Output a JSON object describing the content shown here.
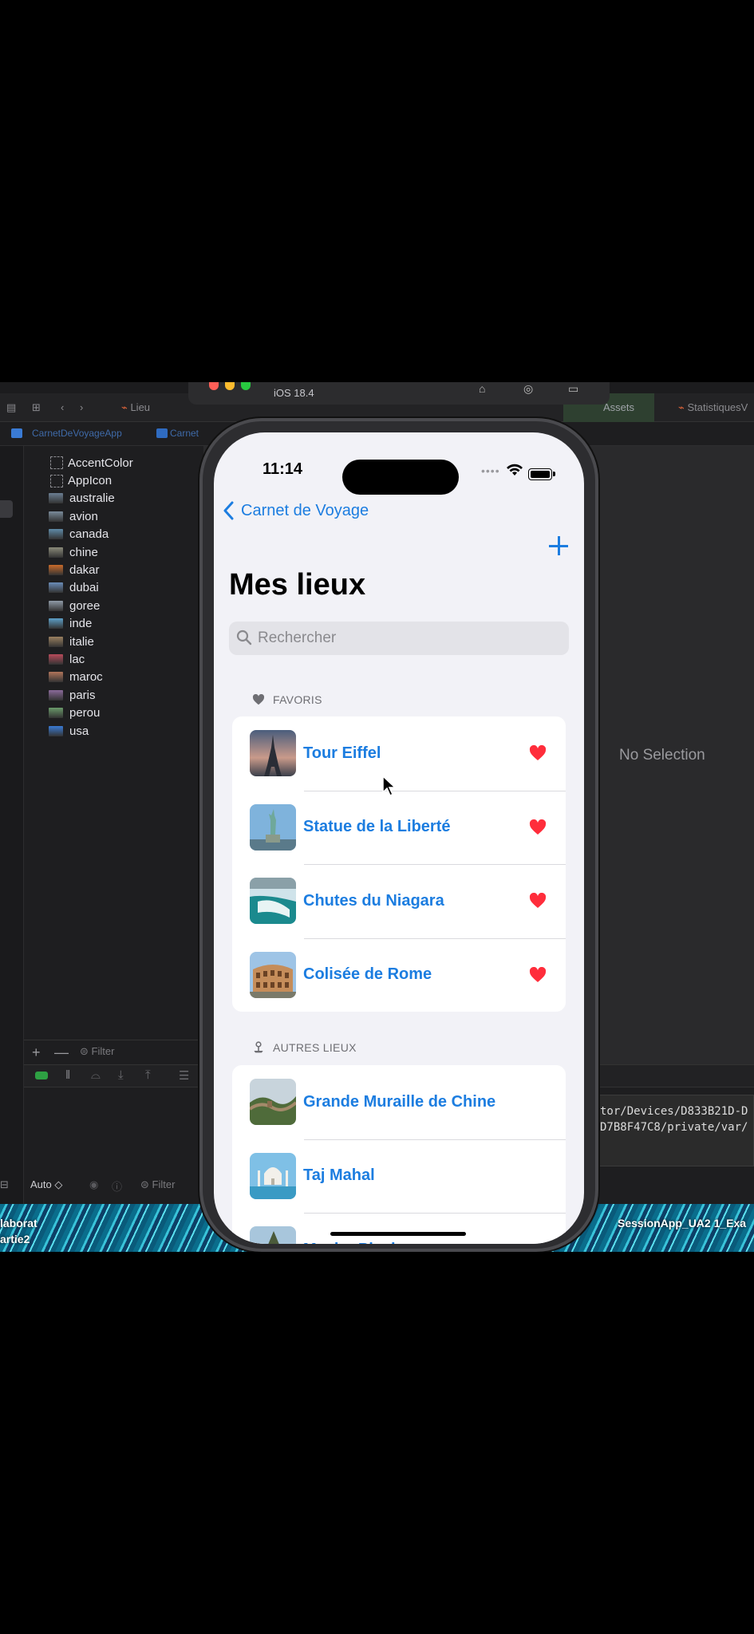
{
  "xcode": {
    "tabs": [
      "Lieu",
      "Assets",
      "StatistiquesV"
    ],
    "path": [
      "CarnetDeVoyageApp",
      "Carnet"
    ],
    "assets": [
      {
        "name": "AccentColor",
        "kind": "color"
      },
      {
        "name": "AppIcon",
        "kind": "icon"
      },
      {
        "name": "australie",
        "kind": "image",
        "color": "#6b7f93"
      },
      {
        "name": "avion",
        "kind": "image",
        "color": "#7a8a9a"
      },
      {
        "name": "canada",
        "kind": "image",
        "color": "#5f8aa8"
      },
      {
        "name": "chine",
        "kind": "image",
        "color": "#8a8a7a"
      },
      {
        "name": "dakar",
        "kind": "image",
        "color": "#c86a2a"
      },
      {
        "name": "dubai",
        "kind": "image",
        "color": "#6a8cb8"
      },
      {
        "name": "goree",
        "kind": "image",
        "color": "#8e9aa6"
      },
      {
        "name": "inde",
        "kind": "image",
        "color": "#5da0c8"
      },
      {
        "name": "italie",
        "kind": "image",
        "color": "#9a8060"
      },
      {
        "name": "lac",
        "kind": "image",
        "color": "#b84b5a"
      },
      {
        "name": "maroc",
        "kind": "image",
        "color": "#b0755a"
      },
      {
        "name": "paris",
        "kind": "image",
        "color": "#8a6a9a"
      },
      {
        "name": "perou",
        "kind": "image",
        "color": "#6a9a6a"
      },
      {
        "name": "usa",
        "kind": "image",
        "color": "#3a7bd5"
      }
    ],
    "filter_placeholder": "Filter",
    "no_selection": "No Selection",
    "console_lines": [
      "tor/Devices/D833B21D-D",
      "D7B8F47C8/private/var/"
    ],
    "auto_label": "Auto ◇",
    "filter2_placeholder": "Filter",
    "simulator_os": "iOS 18.4",
    "desktop_left": [
      "laborat",
      "artie2"
    ],
    "desktop_right": "SessionApp_UA2 1_Exa"
  },
  "phone": {
    "time": "11:14",
    "back_label": "Carnet de Voyage",
    "title": "Mes lieux",
    "search_placeholder": "Rechercher",
    "favorites_header": "FAVORIS",
    "others_header": "AUTRES LIEUX",
    "favorites": [
      {
        "name": "Tour Eiffel",
        "icon": "eiffel"
      },
      {
        "name": "Statue de la Liberté",
        "icon": "liberty"
      },
      {
        "name": "Chutes du Niagara",
        "icon": "niagara"
      },
      {
        "name": "Colisée de Rome",
        "icon": "colosseum"
      }
    ],
    "others": [
      {
        "name": "Grande Muraille de Chine",
        "icon": "great-wall"
      },
      {
        "name": "Taj Mahal",
        "icon": "taj-mahal"
      },
      {
        "name": "Machu Picchu",
        "icon": "machu-picchu"
      }
    ],
    "accent_color": "#1c7de0",
    "heart_color": "#ff2d3b"
  }
}
